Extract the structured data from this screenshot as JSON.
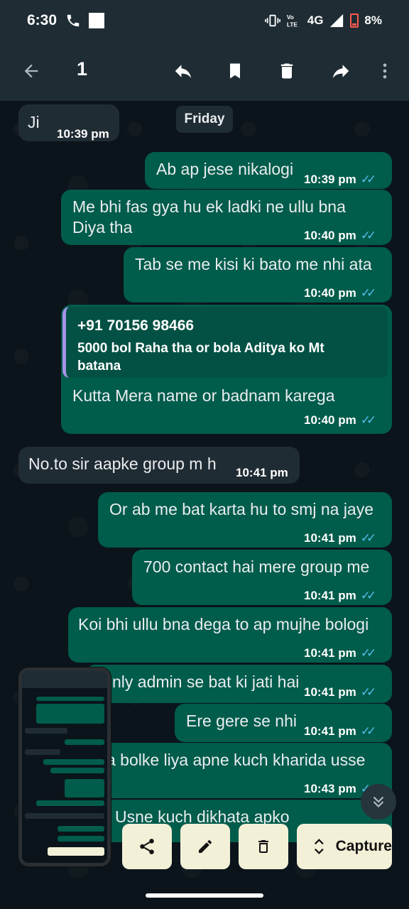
{
  "status_bar": {
    "time": "6:30",
    "network": "4G",
    "battery": "8%"
  },
  "toolbar": {
    "selected_count": "1"
  },
  "chat": {
    "day_chip": "Friday",
    "messages": [
      {
        "text": "Ji",
        "time": "10:39 pm"
      },
      {
        "text": "Ab ap jese nikalogi",
        "time": "10:39 pm"
      },
      {
        "line1": "Me bhi fas gya hu ek ladki ne ullu bna",
        "line2": "Diya tha",
        "time": "10:40 pm"
      },
      {
        "text": "Tab se me kisi ki bato me nhi ata",
        "time": "10:40 pm"
      },
      {
        "quote_name": "+91 70156 98466",
        "quote_line1": "5000 bol Raha tha or bola Aditya ko Mt",
        "quote_line2": "batana",
        "text": "Kutta Mera name or badnam karega",
        "time": "10:40 pm"
      },
      {
        "text": "No.to sir aapke group m h",
        "time": "10:41 pm"
      },
      {
        "text": "Or ab me bat karta hu to smj na jaye",
        "time": "10:41 pm"
      },
      {
        "text": "700 contact hai mere group me",
        "time": "10:41 pm"
      },
      {
        "text": "Koi bhi ullu bna dega to ap mujhe bologi",
        "time": "10:41 pm"
      },
      {
        "text": "nly admin se bat ki jati hai",
        "time": "10:41 pm"
      },
      {
        "text": "Ere gere se nhi",
        "time": "10:41 pm"
      },
      {
        "text": "a bolke liya apne kuch kharida usse",
        "time": "10:43 pm"
      },
      {
        "text": "Usne kuch dikhata apko"
      }
    ]
  },
  "screenshot_overlay": {
    "capture_label": "Capture"
  }
}
